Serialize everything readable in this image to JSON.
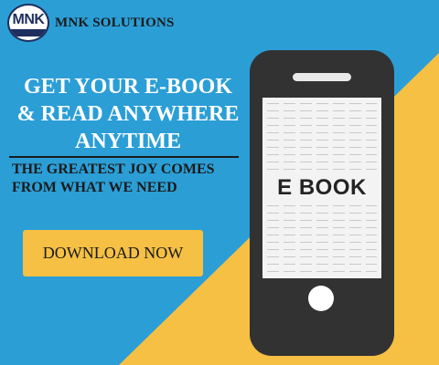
{
  "brand": {
    "badge_text": "MNK",
    "name": "MNK SOLUTIONS"
  },
  "headline": {
    "line1": "GET YOUR E-BOOK",
    "line2": "& READ ANYWHERE",
    "line3": "ANYTIME"
  },
  "subheadline": {
    "line1": "THE GREATEST JOY COMES",
    "line2": "FROM WHAT WE NEED"
  },
  "cta": {
    "label": "DOWNLOAD NOW"
  },
  "phone": {
    "screen_label": "E BOOK"
  },
  "colors": {
    "background_blue": "#2b9ed6",
    "accent_yellow": "#f5c043",
    "phone_body": "#323232",
    "brand_navy": "#1e2f5f"
  },
  "icons": {
    "brand_logo": "mnk-badge-logo",
    "phone": "smartphone-illustration"
  }
}
